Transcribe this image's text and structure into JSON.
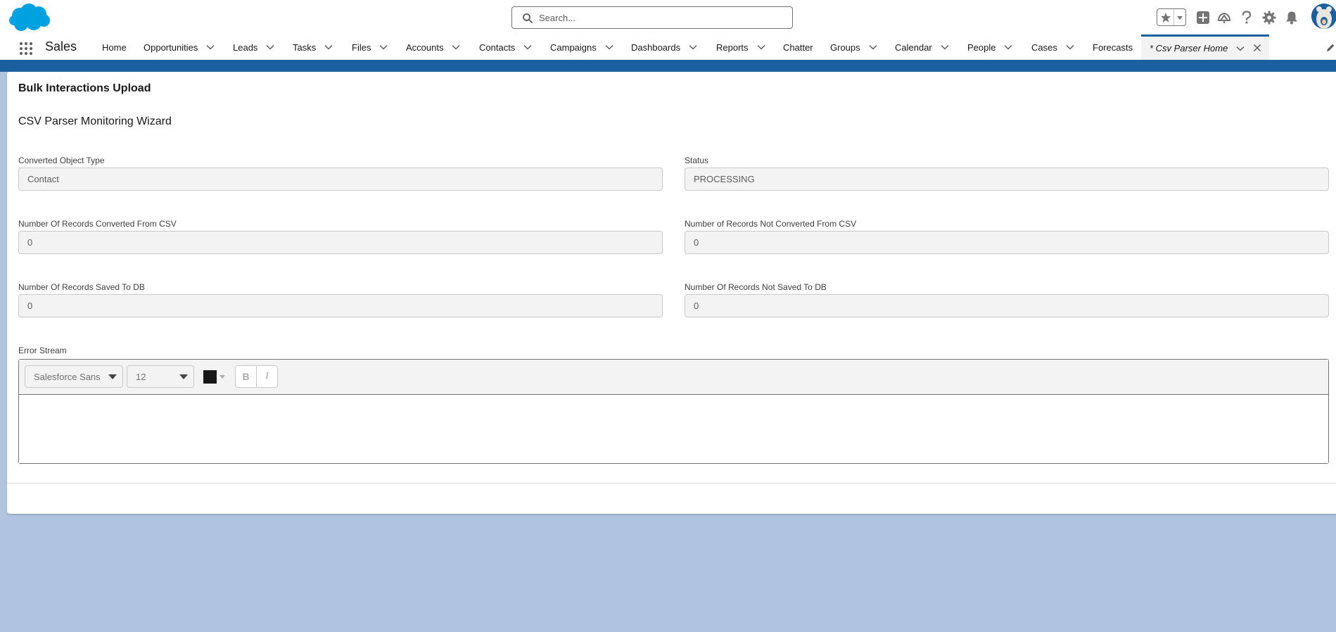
{
  "header": {
    "search_placeholder": "Search...",
    "icons": [
      "cloud-logo-icon",
      "search-icon",
      "star-icon",
      "chevron-down-icon",
      "plus-icon",
      "trailhead-icon",
      "help-icon",
      "gear-icon",
      "bell-icon",
      "avatar"
    ]
  },
  "nav": {
    "app_name": "Sales",
    "items": [
      {
        "label": "Home",
        "has_menu": false
      },
      {
        "label": "Opportunities",
        "has_menu": true
      },
      {
        "label": "Leads",
        "has_menu": true
      },
      {
        "label": "Tasks",
        "has_menu": true
      },
      {
        "label": "Files",
        "has_menu": true
      },
      {
        "label": "Accounts",
        "has_menu": true
      },
      {
        "label": "Contacts",
        "has_menu": true
      },
      {
        "label": "Campaigns",
        "has_menu": true
      },
      {
        "label": "Dashboards",
        "has_menu": true
      },
      {
        "label": "Reports",
        "has_menu": true
      },
      {
        "label": "Chatter",
        "has_menu": false
      },
      {
        "label": "Groups",
        "has_menu": true
      },
      {
        "label": "Calendar",
        "has_menu": true
      },
      {
        "label": "People",
        "has_menu": true
      },
      {
        "label": "Cases",
        "has_menu": true
      },
      {
        "label": "Forecasts",
        "has_menu": false
      }
    ],
    "active_tab": "* Csv Parser Home"
  },
  "card": {
    "title": "Bulk Interactions Upload",
    "wizard_title": "CSV Parser Monitoring Wizard",
    "fields": {
      "object_type": {
        "label": "Converted Object Type",
        "value": "Contact"
      },
      "status": {
        "label": "Status",
        "value": "PROCESSING"
      },
      "converted": {
        "label": "Number Of Records Converted From CSV",
        "value": "0"
      },
      "not_converted": {
        "label": "Number of Records Not Converted From CSV",
        "value": "0"
      },
      "saved": {
        "label": "Number Of Records Saved To DB",
        "value": "0"
      },
      "not_saved": {
        "label": "Number Of Records Not Saved To DB",
        "value": "0"
      }
    },
    "error_stream": {
      "label": "Error Stream",
      "font": "Salesforce Sans",
      "size": "12",
      "bold": "B",
      "italic": "I",
      "text_color": "#181818",
      "content": ""
    }
  },
  "colors": {
    "brand": "#1b5f9e",
    "background": "#b0c4df",
    "logo": "#00a1e0"
  }
}
